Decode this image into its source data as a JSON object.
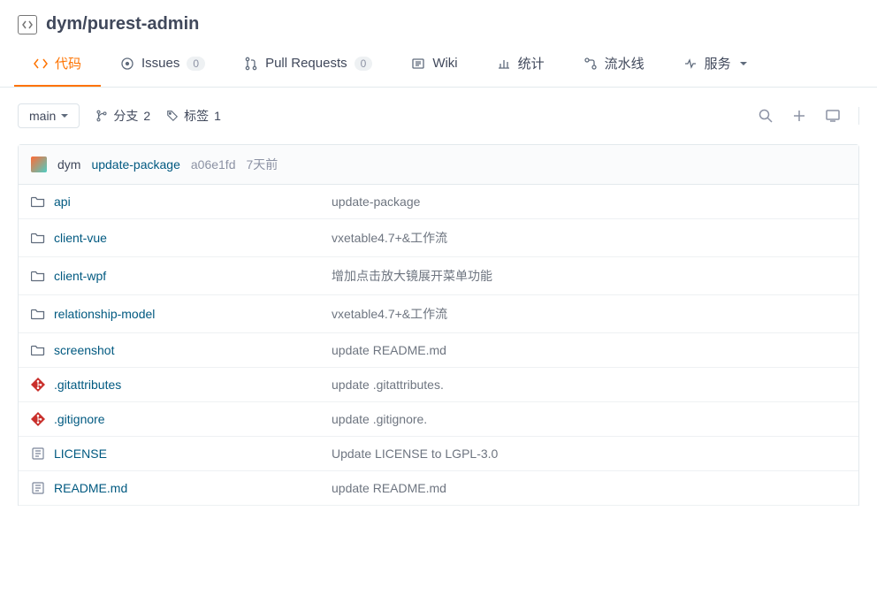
{
  "repo": {
    "owner": "dym",
    "name": "purest-admin"
  },
  "tabs": {
    "code": "代码",
    "issues": "Issues",
    "issues_count": "0",
    "prs": "Pull Requests",
    "prs_count": "0",
    "wiki": "Wiki",
    "stats": "统计",
    "pipeline": "流水线",
    "services": "服务"
  },
  "toolbar": {
    "branch": "main",
    "branches_label": "分支",
    "branches_count": "2",
    "tags_label": "标签",
    "tags_count": "1"
  },
  "commit": {
    "author": "dym",
    "message": "update-package",
    "hash": "a06e1fd",
    "time": "7天前"
  },
  "files": [
    {
      "type": "folder",
      "name": "api",
      "msg": "update-package"
    },
    {
      "type": "folder",
      "name": "client-vue",
      "msg": "vxetable4.7+&工作流"
    },
    {
      "type": "folder",
      "name": "client-wpf",
      "msg": "增加点击放大镜展开菜单功能"
    },
    {
      "type": "folder",
      "name": "relationship-model",
      "msg": "vxetable4.7+&工作流"
    },
    {
      "type": "folder",
      "name": "screenshot",
      "msg": "update README.md"
    },
    {
      "type": "git",
      "name": ".gitattributes",
      "msg": "update .gitattributes."
    },
    {
      "type": "git",
      "name": ".gitignore",
      "msg": "update .gitignore."
    },
    {
      "type": "doc",
      "name": "LICENSE",
      "msg": "Update LICENSE to LGPL-3.0"
    },
    {
      "type": "doc",
      "name": "README.md",
      "msg": "update README.md"
    }
  ]
}
